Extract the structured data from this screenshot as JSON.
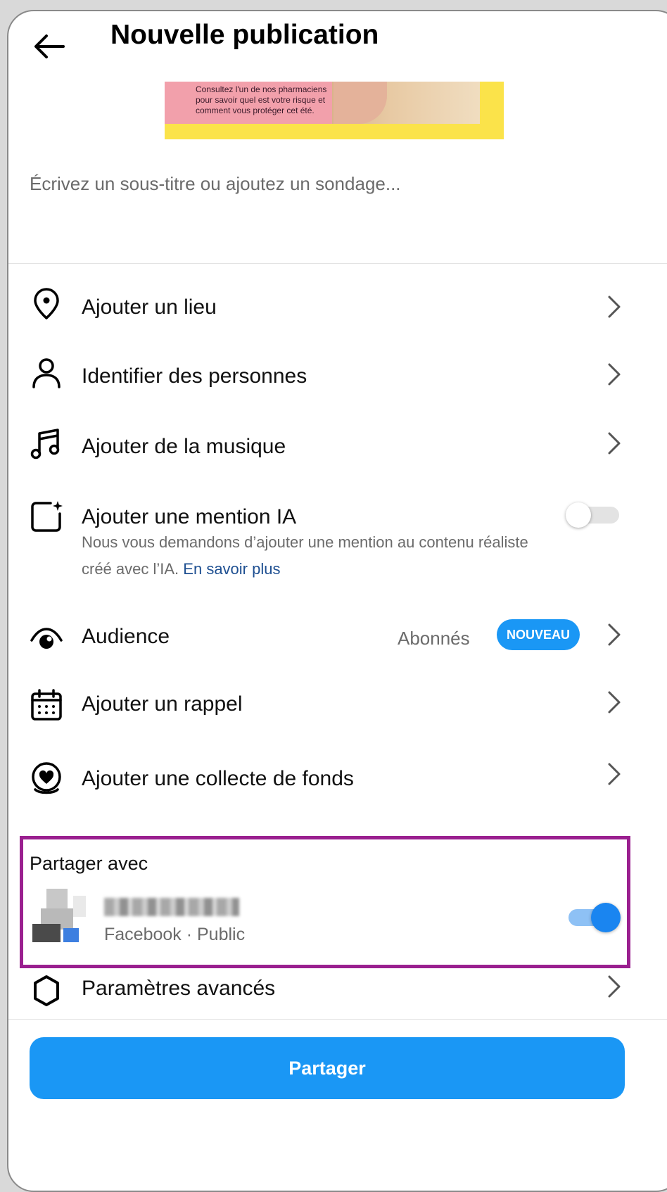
{
  "header": {
    "title": "Nouvelle publication"
  },
  "preview": {
    "text": "Consultez l'un de nos pharmaciens pour savoir quel est votre risque et comment vous protéger cet été."
  },
  "caption": {
    "placeholder": "Écrivez un sous-titre ou ajoutez un sondage..."
  },
  "options": {
    "location": "Ajouter un lieu",
    "tag_people": "Identifier des personnes",
    "music": "Ajouter de la musique",
    "ai_label": {
      "label": "Ajouter une mention IA",
      "description": "Nous vous demandons d’ajouter une mention au contenu réaliste créé avec l’IA.",
      "link": "En savoir plus",
      "enabled": false
    },
    "audience": {
      "label": "Audience",
      "value": "Abonnés",
      "badge": "NOUVEAU"
    },
    "reminder": "Ajouter un rappel",
    "fundraiser": "Ajouter une collecte de fonds",
    "advanced": "Paramètres avancés"
  },
  "share_with": {
    "title": "Partager avec",
    "account_subtitle": "Facebook · Public",
    "enabled": true
  },
  "footer": {
    "share_button": "Partager"
  },
  "colors": {
    "accent": "#1a97f5",
    "highlight_border": "#9a1f8f",
    "link": "#1e4f91"
  }
}
